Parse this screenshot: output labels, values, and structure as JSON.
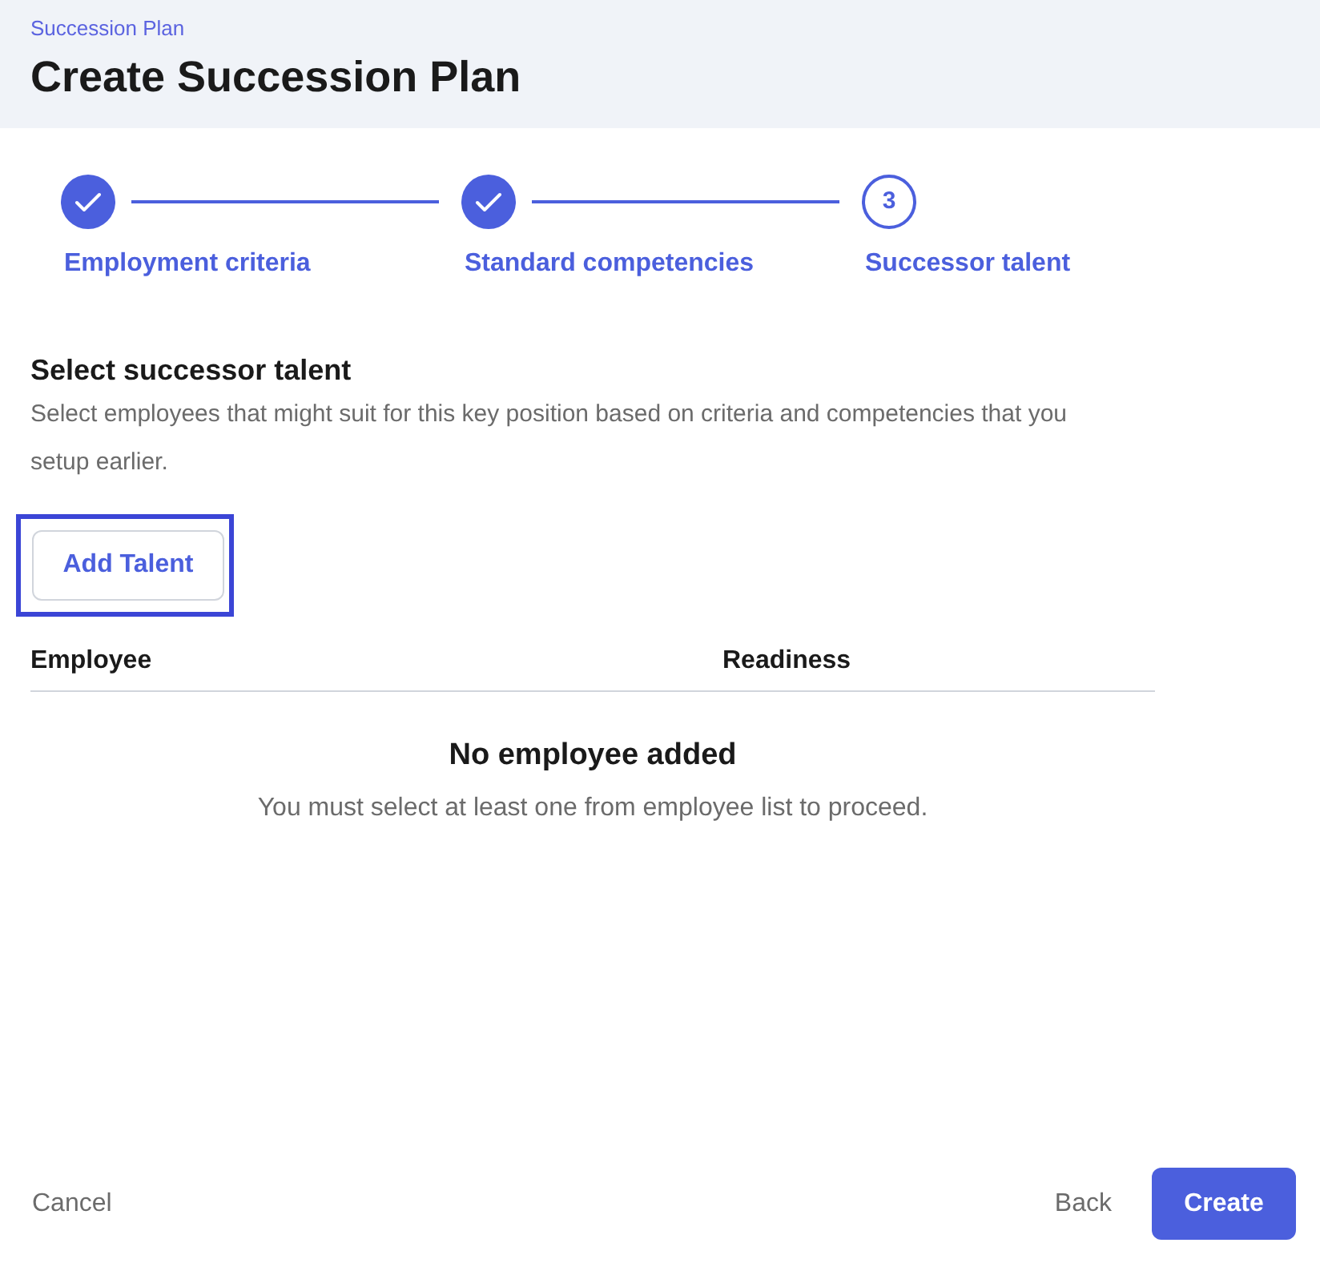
{
  "header": {
    "breadcrumb": "Succession Plan",
    "title": "Create Succession Plan"
  },
  "steps": [
    {
      "label": "Employment criteria",
      "completed": true
    },
    {
      "label": "Standard competencies",
      "completed": true
    },
    {
      "number": "3",
      "label": "Successor talent",
      "completed": false
    }
  ],
  "section": {
    "title": "Select successor talent",
    "description": "Select employees that might suit for this key position based on criteria and competencies that you setup earlier."
  },
  "add_button": {
    "label": "Add Talent",
    "focused": true
  },
  "table": {
    "columns": [
      "Employee",
      "Readiness"
    ],
    "empty_title": "No employee added",
    "empty_message": "You must select at least one from employee list to proceed."
  },
  "footer": {
    "cancel": "Cancel",
    "back": "Back",
    "create": "Create"
  }
}
